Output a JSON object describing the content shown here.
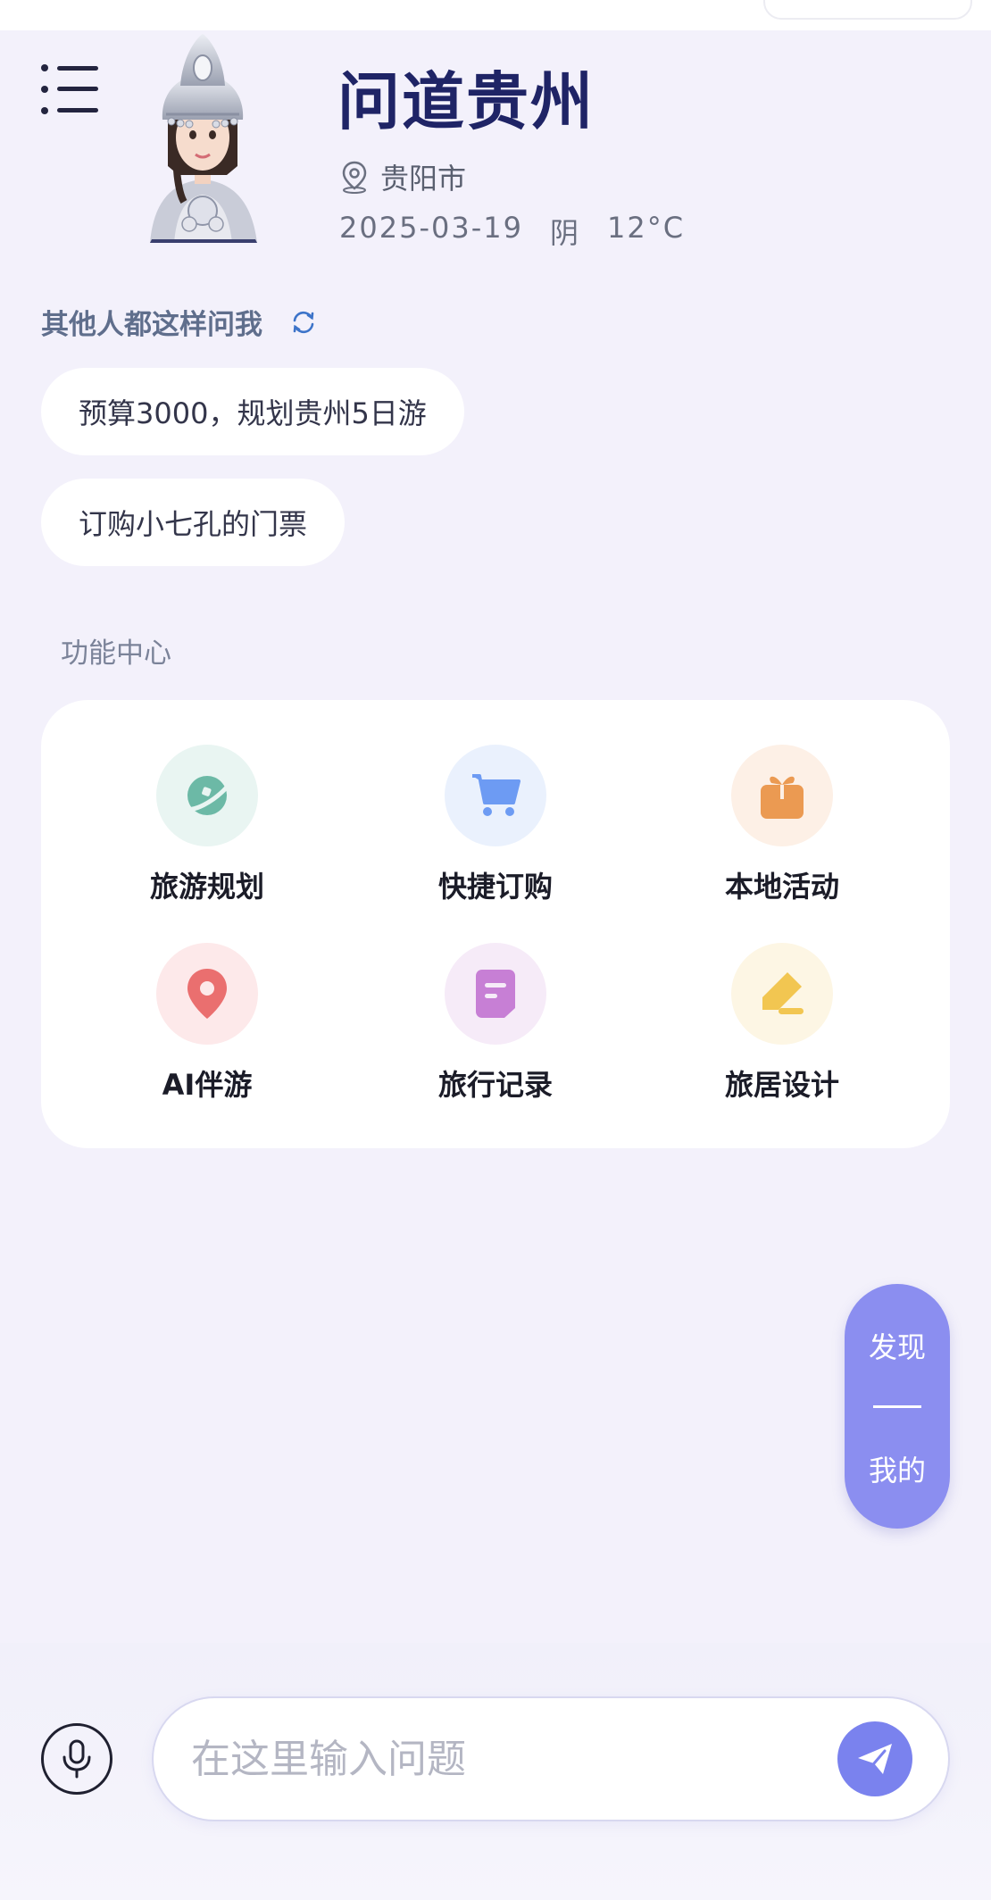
{
  "header": {
    "app_title": "问道贵州",
    "city": "贵阳市",
    "date": "2025-03-19",
    "weather": "阴",
    "temperature": "12°C"
  },
  "suggestions": {
    "title": "其他人都这样问我",
    "items": [
      "预算3000，规划贵州5日游",
      "订购小七孔的门票"
    ]
  },
  "functions": {
    "title": "功能中心",
    "items": [
      {
        "label": "旅游规划",
        "icon": "planet-icon",
        "color": "#6cb9a6",
        "bg": "#e9f5f2"
      },
      {
        "label": "快捷订购",
        "icon": "cart-icon",
        "color": "#6d9bf3",
        "bg": "#eaf1fd"
      },
      {
        "label": "本地活动",
        "icon": "gift-icon",
        "color": "#eb9a52",
        "bg": "#fdf0e6"
      },
      {
        "label": "AI伴游",
        "icon": "location-pin-icon",
        "color": "#ea6f6f",
        "bg": "#fde9ea"
      },
      {
        "label": "旅行记录",
        "icon": "note-icon",
        "color": "#c77fd5",
        "bg": "#f6ebf8"
      },
      {
        "label": "旅居设计",
        "icon": "pen-icon",
        "color": "#f2c651",
        "bg": "#fdf6e4"
      }
    ]
  },
  "side_pill": {
    "discover": "发现",
    "mine": "我的"
  },
  "input": {
    "placeholder": "在这里输入问题"
  },
  "colors": {
    "accent": "#8b8ef0",
    "title": "#1f2466",
    "background": "#f3f1fb"
  }
}
